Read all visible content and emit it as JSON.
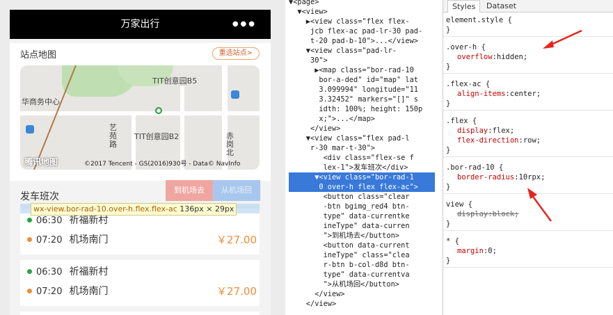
{
  "app": {
    "title": "万家出行",
    "menu_dots": "●●●"
  },
  "map_section": {
    "title": "站点地图",
    "choose_btn": "重选站点>",
    "labels": [
      "TIT创意园B5",
      "华商务中心",
      "TIT创意园B2",
      "艺苑路",
      "赤岗北"
    ],
    "logo": "腾讯地图",
    "credit": "©2017 Tencent - GS(2016)930号 - Data© NavInfo"
  },
  "schedule": {
    "title": "发车班次",
    "btn_airport": "到机场去",
    "btn_from": "从机场回",
    "tooltip_name": "wx-view.bor-rad-10.over-h.flex.flex-ac",
    "tooltip_size": "136px × 29px",
    "trips": [
      {
        "t1": "06:30",
        "p1": "祈福新村",
        "t2": "07:20",
        "p2": "机场南门",
        "price": "￥27.00"
      },
      {
        "t1": "06:30",
        "p1": "祈福新村",
        "t2": "07:20",
        "p2": "机场南门",
        "price": "￥27.00"
      }
    ],
    "colors": {
      "depart": "#22a83a",
      "arrive": "#ef8d37"
    }
  },
  "elements_panel": {
    "lines": [
      "▼<page>",
      "  ▼<view>",
      "    ▶<view class=\"flex flex-",
      "     jcb flex-ac pad-lr-30 pad-",
      "     t-20 pad-b-10\">...</view>",
      "    ▼<view class=\"pad-lr-",
      "     30\">",
      "      ▶<map class=\"bor-rad-10",
      "       bor-a-ded\" id=\"map\" lat",
      "       3.099994\" longitude=\"11",
      "       3.32452\" markers=\"[]\" s",
      "       idth: 100%; height: 150p",
      "       x;\">...</map>",
      "     </view>",
      "    ▼<view class=\"flex pad-l",
      "     r-30 mar-t-30\">",
      "        <div class=\"flex-se f",
      "        lex-1\">发车班次</div>",
      "      ▼<view class=\"bor-rad-1",
      "       0 over-h flex flex-ac\">",
      "        <button class=\"clear",
      "        -btn bgimg_red4 btn-",
      "        type\" data-currentke",
      "        ineType\" data-curren",
      "        \">到机场去</button>",
      "        <button data-current",
      "        ineType\" class=\"clea",
      "        r-btn b-col-d8d btn-",
      "        type\" data-currentva",
      "        \">从机场回</button>",
      "      </view>",
      "    </view>"
    ]
  },
  "styles_panel": {
    "tabs": [
      "Styles",
      "Dataset"
    ],
    "rules": [
      {
        "selector": "element.style {",
        "props": [],
        "close": "}"
      },
      {
        "selector": ".over-h {",
        "props": [
          {
            "name": "overflow",
            "value": "hidden;",
            "struck": false
          }
        ],
        "close": "}"
      },
      {
        "selector": ".flex-ac {",
        "props": [
          {
            "name": "align-items",
            "value": "center;",
            "struck": false
          }
        ],
        "close": "}"
      },
      {
        "selector": ".flex {",
        "props": [
          {
            "name": "display",
            "value": "flex;",
            "struck": false
          },
          {
            "name": "flex-direction",
            "value": "row;",
            "struck": false
          }
        ],
        "close": "}"
      },
      {
        "selector": ".bor-rad-10 {",
        "props": [
          {
            "name": "border-radius",
            "value": "10rpx;",
            "struck": false
          }
        ],
        "close": "}"
      },
      {
        "selector": "view {",
        "props": [
          {
            "name": "display",
            "value": "block;",
            "struck": true
          }
        ],
        "close": "}"
      },
      {
        "selector": "* {",
        "props": [
          {
            "name": "margin",
            "value": "0;",
            "struck": false
          }
        ],
        "close": "}"
      }
    ]
  }
}
